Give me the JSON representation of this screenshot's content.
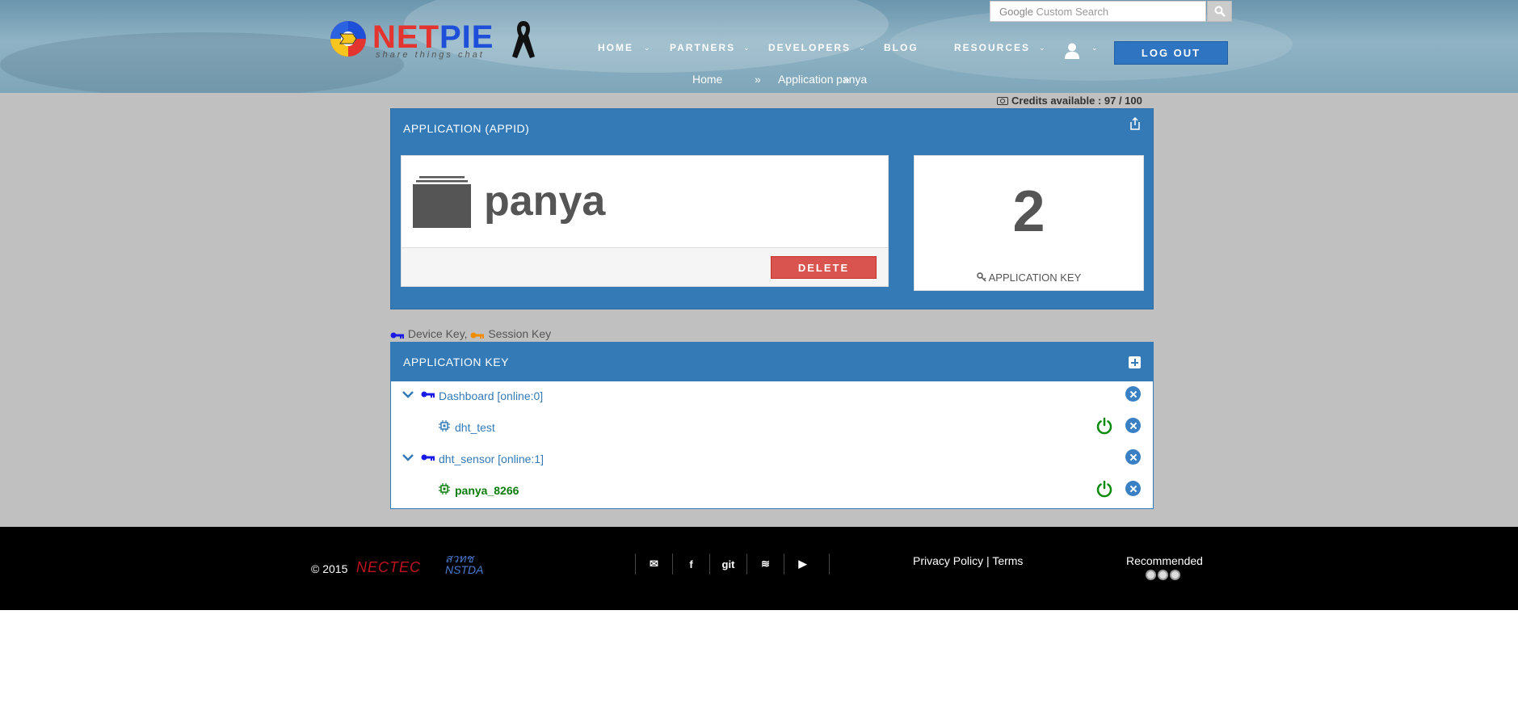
{
  "header": {
    "brand_net": "NET",
    "brand_pie": "PIE",
    "tagline": "share things chat",
    "search": {
      "google_label": "Google",
      "placeholder": "Custom Search",
      "value": ""
    },
    "nav": [
      {
        "label": "HOME"
      },
      {
        "label": "PARTNERS"
      },
      {
        "label": "DEVELOPERS"
      },
      {
        "label": "BLOG"
      },
      {
        "label": "RESOURCES"
      }
    ],
    "logout_label": "LOG OUT"
  },
  "breadcrumb": {
    "home": "Home",
    "sep": "»",
    "application": "Application",
    "current": "panya"
  },
  "credits": {
    "label": "Credits available : 97 / 100"
  },
  "app_panel": {
    "title": "APPLICATION (APPID)",
    "app_name": "panya",
    "delete_label": "DELETE",
    "key_count": "2",
    "key_label": "APPLICATION KEY"
  },
  "legend": {
    "device_key": "Device Key,",
    "session_key": "Session Key"
  },
  "keys_panel": {
    "title": "APPLICATION KEY",
    "rows": [
      {
        "type": "key",
        "label": "Dashboard [online:0]"
      },
      {
        "type": "device",
        "label": "dht_test",
        "online": false
      },
      {
        "type": "key",
        "label": "dht_sensor [online:1]"
      },
      {
        "type": "device",
        "label": "panya_8266",
        "online": true
      }
    ]
  },
  "footer": {
    "copyright": "© 2015",
    "nectec": "NECTEC",
    "nstda_line1": "สวทช",
    "nstda_line2": "NSTDA",
    "social": [
      "✉",
      "f",
      "git",
      "≋",
      "▶"
    ],
    "privacy": "Privacy Policy",
    "terms_sep": "|",
    "terms": "Terms",
    "recommended": "Recommended"
  },
  "colors": {
    "primary": "#337ab7",
    "danger": "#d9534f",
    "online": "#0a7d0a",
    "device_key": "#1a1ae6",
    "session_key": "#f08c00"
  }
}
